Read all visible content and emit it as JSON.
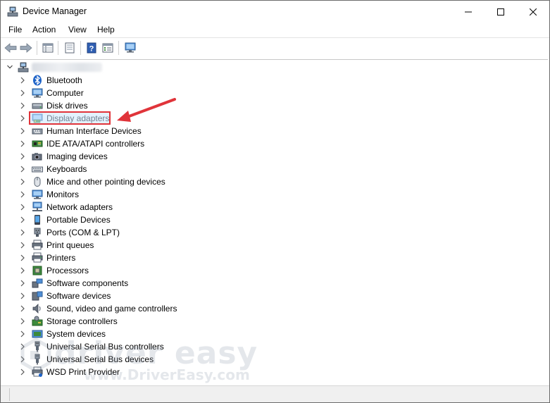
{
  "window": {
    "title": "Device Manager",
    "controls": [
      "minimize-icon",
      "maximize-icon",
      "close-icon"
    ]
  },
  "menu": {
    "items": [
      "File",
      "Action",
      "View",
      "Help"
    ]
  },
  "toolbar": {
    "buttons": [
      "back-icon",
      "forward-icon",
      "properties-grid-icon",
      "document-icon",
      "help-icon",
      "list-view-icon",
      "monitor-scan-icon"
    ]
  },
  "tree": {
    "root": {
      "label": "",
      "icon": "computer-root-icon"
    },
    "items": [
      {
        "label": "Bluetooth",
        "icon": "bluetooth-icon"
      },
      {
        "label": "Computer",
        "icon": "computer-icon"
      },
      {
        "label": "Disk drives",
        "icon": "disk-drive-icon"
      },
      {
        "label": "Display adapters",
        "icon": "display-adapter-icon",
        "highlighted": true
      },
      {
        "label": "Human Interface Devices",
        "icon": "hid-icon"
      },
      {
        "label": "IDE ATA/ATAPI controllers",
        "icon": "ide-controller-icon"
      },
      {
        "label": "Imaging devices",
        "icon": "camera-icon"
      },
      {
        "label": "Keyboards",
        "icon": "keyboard-icon"
      },
      {
        "label": "Mice and other pointing devices",
        "icon": "mouse-icon"
      },
      {
        "label": "Monitors",
        "icon": "monitor-icon"
      },
      {
        "label": "Network adapters",
        "icon": "network-icon"
      },
      {
        "label": "Portable Devices",
        "icon": "portable-device-icon"
      },
      {
        "label": "Ports (COM & LPT)",
        "icon": "port-icon"
      },
      {
        "label": "Print queues",
        "icon": "print-queue-icon"
      },
      {
        "label": "Printers",
        "icon": "printer-icon"
      },
      {
        "label": "Processors",
        "icon": "processor-icon"
      },
      {
        "label": "Software components",
        "icon": "software-component-icon"
      },
      {
        "label": "Software devices",
        "icon": "software-device-icon"
      },
      {
        "label": "Sound, video and game controllers",
        "icon": "speaker-icon"
      },
      {
        "label": "Storage controllers",
        "icon": "storage-controller-icon"
      },
      {
        "label": "System devices",
        "icon": "system-device-icon"
      },
      {
        "label": "Universal Serial Bus controllers",
        "icon": "usb-icon"
      },
      {
        "label": "Universal Serial Bus devices",
        "icon": "usb-icon"
      },
      {
        "label": "WSD Print Provider",
        "icon": "wsd-printer-icon"
      }
    ]
  },
  "watermark": {
    "brand": "driver easy",
    "url": "www.DriverEasy.com"
  },
  "colors": {
    "highlight_border": "#e0343a",
    "arrow": "#e0343a",
    "selection_fill": "#cce8ff"
  }
}
